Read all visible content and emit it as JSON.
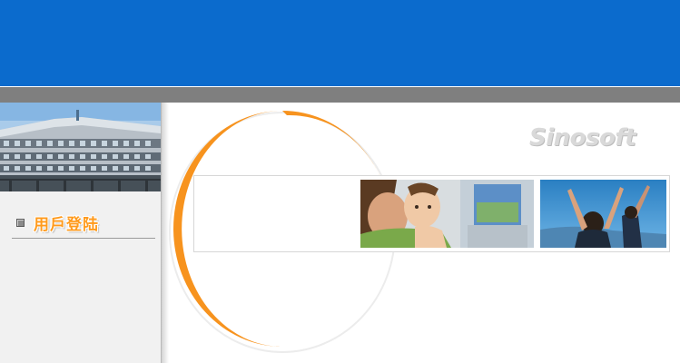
{
  "sidebar": {
    "menu": [
      {
        "label": "用戶登陆",
        "icon": "square-bullet-icon"
      }
    ]
  },
  "main": {
    "logo_text": "Sinosoft"
  },
  "colors": {
    "banner_blue": "#0b6bcd",
    "grey_bar": "#7f7f7f",
    "accent_orange": "#f7931e",
    "sidebar_bg": "#f1f1f1"
  }
}
